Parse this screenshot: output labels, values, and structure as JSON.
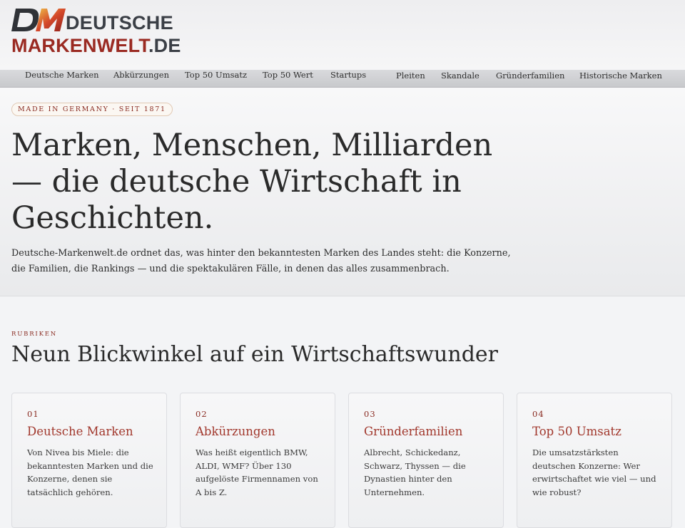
{
  "header": {
    "logo": {
      "monogram": "DM",
      "line1": "DEUTSCHE",
      "line2_a": "MARKENWELT",
      "line2_b": ".DE"
    }
  },
  "nav": {
    "items": [
      "Deutsche Marken",
      "Abkürzungen",
      "Top 50 Umsatz",
      "Top 50 Wert",
      "Startups",
      "Pleiten",
      "Skandale",
      "Gründerfamilien",
      "Historische Marken"
    ]
  },
  "hero": {
    "badge": "MADE IN GERMANY · SEIT 1871",
    "headline": "Marken, Menschen, Milliarden — die deutsche Wirtschaft in Geschichten.",
    "intro": "Deutsche-Markenwelt.de ordnet das, was hinter den bekanntesten Marken des Landes steht: die Konzerne, die Familien, die Rankings — und die spektakulären Fälle, in denen das alles zusammenbrach."
  },
  "section": {
    "label": "RUBRIKEN",
    "title": "Neun Blickwinkel auf ein Wirtschaftswunder"
  },
  "cards": [
    {
      "num": "01",
      "title": "Deutsche Marken",
      "desc": "Von Nivea bis Miele: die bekanntesten Marken und die Konzerne, denen sie tatsächlich gehören."
    },
    {
      "num": "02",
      "title": "Abkürzungen",
      "desc": "Was heißt eigentlich BMW, ALDI, WMF? Über 130 aufgelöste Firmennamen von A bis Z."
    },
    {
      "num": "03",
      "title": "Gründerfamilien",
      "desc": "Albrecht, Schickedanz, Schwarz, Thyssen — die Dynastien hinter den Unternehmen."
    },
    {
      "num": "04",
      "title": "Top 50 Umsatz",
      "desc": "Die umsatzstärksten deutschen Konzerne: Wer erwirtschaftet wie viel — und wie robust?"
    }
  ],
  "colors": {
    "accent": "#8a2c22",
    "card_title": "#a1372c",
    "logo_gray": "#3b3f46",
    "logo_red": "#9a2a22"
  }
}
